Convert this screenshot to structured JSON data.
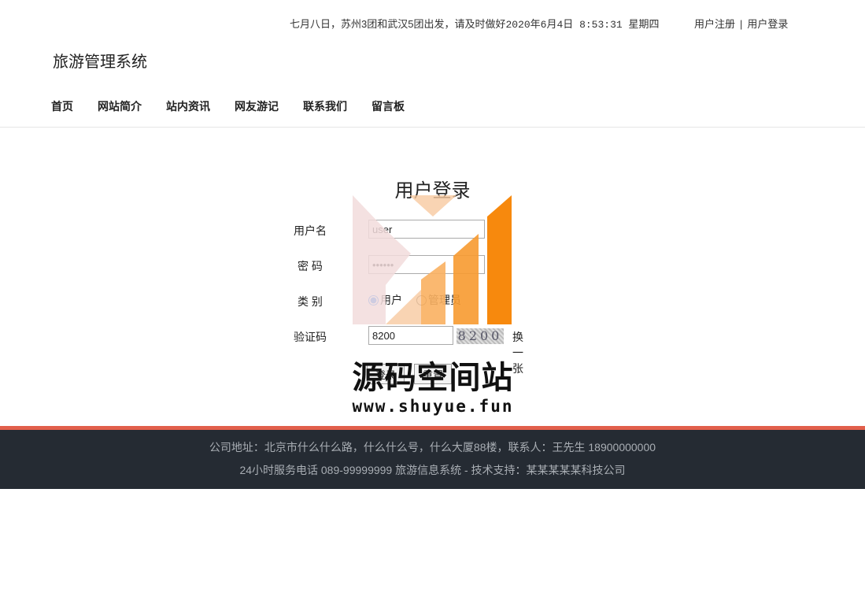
{
  "topbar": {
    "notice": "七月八日，苏州3团和武汉5团出发，请及时做好",
    "datetime": "2020年6月4日 8:53:31 星期四",
    "register_label": "用户注册",
    "separator": "|",
    "login_label": "用户登录"
  },
  "site": {
    "title": "旅游管理系统"
  },
  "nav": {
    "items": [
      {
        "label": "首页"
      },
      {
        "label": "网站简介"
      },
      {
        "label": "站内资讯"
      },
      {
        "label": "网友游记"
      },
      {
        "label": "联系我们"
      },
      {
        "label": "留言板"
      }
    ]
  },
  "login": {
    "title": "用户登录",
    "username_label": "用户名",
    "username_value": "user",
    "password_label": "密 码",
    "password_value": "111111",
    "type_label": "类 别",
    "type_options": [
      "用户",
      "管理员"
    ],
    "type_selected": "用户",
    "captcha_label": "验证码",
    "captcha_value": "8200",
    "captcha_image_text": "8200",
    "refresh_label": "换一张",
    "submit_label": "登录",
    "reset_label": "重置"
  },
  "watermark": {
    "text": "源码空间站",
    "url": "www.shuyue.fun"
  },
  "footer": {
    "line1": "公司地址：北京市什么什么路，什么什么号，什么大厦88楼，联系人：王先生 18900000000",
    "line2": "24小时服务电话   089-99999999   旅游信息系统 - 技术支持：某某某某某科技公司"
  },
  "colors": {
    "footer_bg": "#252b33",
    "footer_accent": "#e25f4b",
    "watermark_orange": "#f7890d"
  }
}
